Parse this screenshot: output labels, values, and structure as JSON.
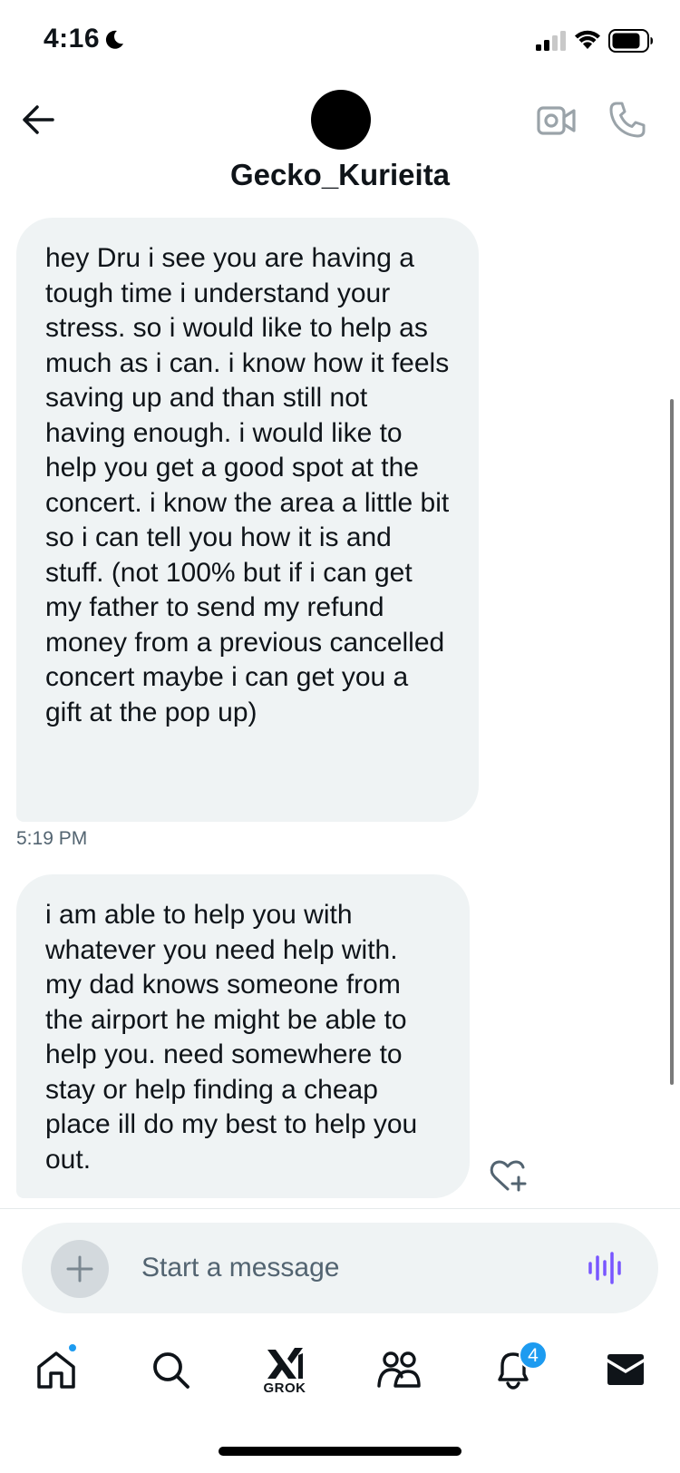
{
  "status_bar": {
    "time": "4:16"
  },
  "header": {
    "username": "Gecko_Kurieita"
  },
  "messages": [
    {
      "text": "hey Dru i see you are having a tough time i understand your stress. so i would like to help as much as i can. i know how it feels saving up and than still not having enough. i would like to help you get a good spot at the concert. i know the area a little bit so i can tell you how it is and stuff. (not 100% but if i can get my father to send my refund money from a previous cancelled concert maybe i can get you a gift at the pop up)",
      "time": "5:19 PM"
    },
    {
      "text": "i am able to help you with whatever you need help with. my dad knows someone from the airport he might be able to help you. need somewhere to stay or help finding a cheap place ill do my best to help you out."
    }
  ],
  "composer": {
    "placeholder": "Start a message"
  },
  "nav": {
    "grok_label": "GROK",
    "notifications_count": "4"
  },
  "colors": {
    "accent": "#1d9bf0",
    "bubble": "#eff3f4",
    "voice": "#7856ff"
  }
}
